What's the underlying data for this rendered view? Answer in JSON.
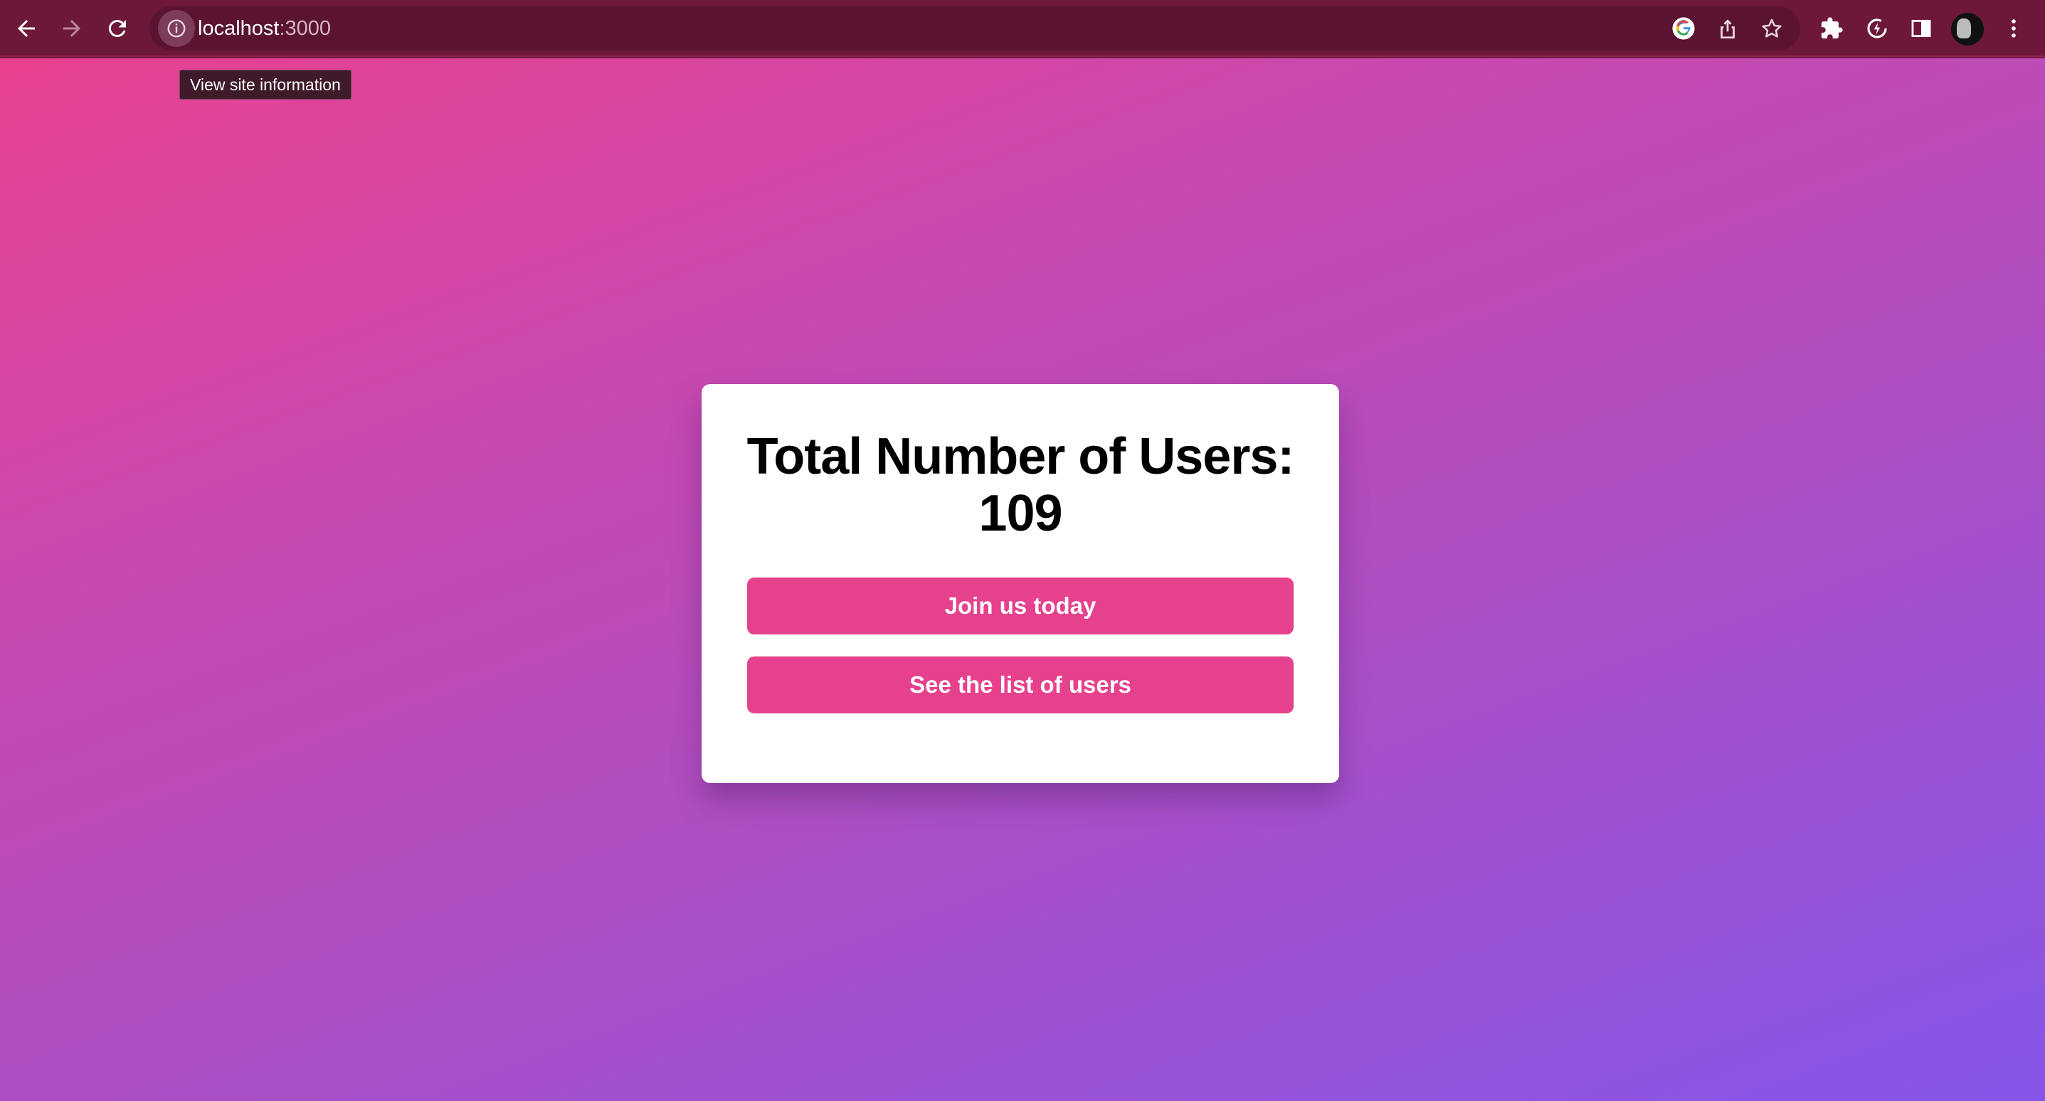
{
  "browser": {
    "url_host": "localhost",
    "url_port": ":3000",
    "tooltip": "View site information",
    "icons": [
      "back-arrow-icon",
      "forward-arrow-icon",
      "reload-icon",
      "info-icon",
      "google-icon",
      "share-icon",
      "star-icon",
      "extensions-icon",
      "extension-icon",
      "side-panel-icon",
      "profile-avatar",
      "kebab-menu-icon"
    ]
  },
  "page": {
    "title_line1": "Total Number of Users:",
    "user_count": "109",
    "join_button": "Join us today",
    "list_button": "See the list of users"
  },
  "colors": {
    "toolbar": "#6d1839",
    "button": "#e6418d",
    "gradient_start": "#e8418f",
    "gradient_end": "#8556e9"
  }
}
